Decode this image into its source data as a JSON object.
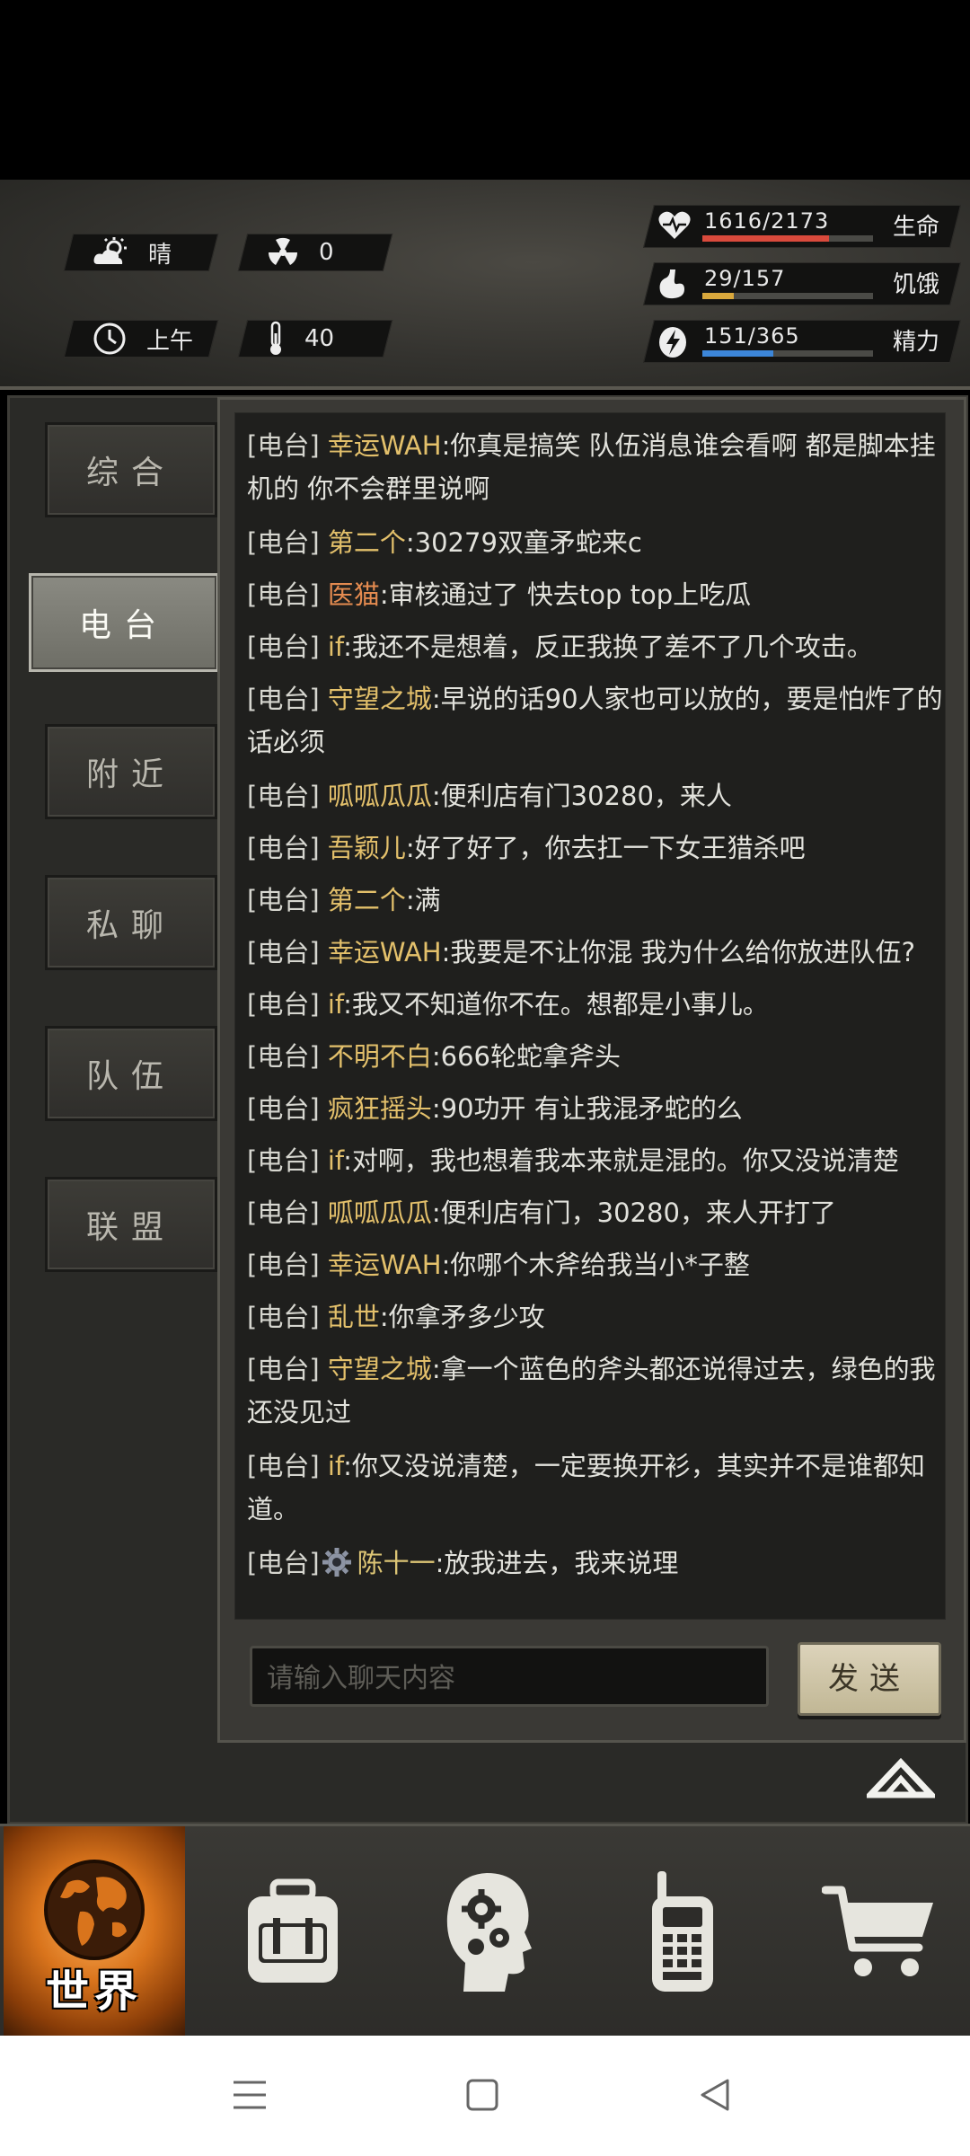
{
  "status": {
    "weather": "晴",
    "radiation": "0",
    "time_of_day": "上午",
    "temperature": "40",
    "bars": [
      {
        "label": "生命",
        "value_text": "1616/2173",
        "current": 1616,
        "max": 2173,
        "color": "#d94a3c",
        "icon": "heart-pulse-icon"
      },
      {
        "label": "饥饿",
        "value_text": "29/157",
        "current": 29,
        "max": 157,
        "color": "#d9a83c",
        "icon": "stomach-icon"
      },
      {
        "label": "精力",
        "value_text": "151/365",
        "current": 151,
        "max": 365,
        "color": "#3c86d9",
        "icon": "energy-icon"
      }
    ]
  },
  "tabs": [
    {
      "label": "综合",
      "active": false
    },
    {
      "label": "电台",
      "active": true
    },
    {
      "label": "附近",
      "active": false
    },
    {
      "label": "私聊",
      "active": false
    },
    {
      "label": "队伍",
      "active": false
    },
    {
      "label": "联盟",
      "active": false
    }
  ],
  "messages": [
    {
      "prefix": "[电台]",
      "name": "幸运WAH",
      "text": ":你真是搞笑 队伍消息谁会看啊 都是脚本挂机的 你不会群里说啊"
    },
    {
      "prefix": "[电台]",
      "name": "第二个",
      "text": ":30279双童矛蛇来c"
    },
    {
      "prefix": "[电台]",
      "name": "医猫",
      "text": ":审核通过了 快去top top上吃瓜"
    },
    {
      "prefix": "[电台]",
      "name": "if",
      "text": ":我还不是想着，反正我换了差不了几个攻击。"
    },
    {
      "prefix": "[电台]",
      "name": "守望之城",
      "text": ":早说的话90人家也可以放的，要是怕炸了的话必须"
    },
    {
      "prefix": "[电台]",
      "name": "呱呱瓜瓜",
      "text": ":便利店有门30280，来人"
    },
    {
      "prefix": "[电台]",
      "name": "吾颖儿",
      "text": ":好了好了，你去扛一下女王猎杀吧"
    },
    {
      "prefix": "[电台]",
      "name": "第二个",
      "text": ":满"
    },
    {
      "prefix": "[电台]",
      "name": "幸运WAH",
      "text": ":我要是不让你混 我为什么给你放进队伍?"
    },
    {
      "prefix": "[电台]",
      "name": "if",
      "text": ":我又不知道你不在。想都是小事儿。"
    },
    {
      "prefix": "[电台]",
      "name": "不明不白",
      "text": ":666轮蛇拿斧头"
    },
    {
      "prefix": "[电台]",
      "name": "疯狂摇头",
      "text": ":90功开 有让我混矛蛇的么"
    },
    {
      "prefix": "[电台]",
      "name": "if",
      "text": ":对啊，我也想着我本来就是混的。你又没说清楚"
    },
    {
      "prefix": "[电台]",
      "name": "呱呱瓜瓜",
      "text": ":便利店有门，30280，来人开打了"
    },
    {
      "prefix": "[电台]",
      "name": "幸运WAH",
      "text": ":你哪个木斧给我当小*子整"
    },
    {
      "prefix": "[电台]",
      "name": "乱世",
      "text": ":你拿矛多少攻"
    },
    {
      "prefix": "[电台]",
      "name": "守望之城",
      "text": ":拿一个蓝色的斧头都还说得过去，绿色的我还没见过"
    },
    {
      "prefix": "[电台]",
      "name": "if",
      "text": ":你又没说清楚，一定要换开衫，其实并不是谁都知道。"
    },
    {
      "prefix": "[电台]",
      "name": "陈十一",
      "text": ":放我进去，我来说理"
    }
  ],
  "chat_input": {
    "placeholder": "请输入聊天内容"
  },
  "send_label": "发送",
  "nav": {
    "world_label": "世界"
  }
}
